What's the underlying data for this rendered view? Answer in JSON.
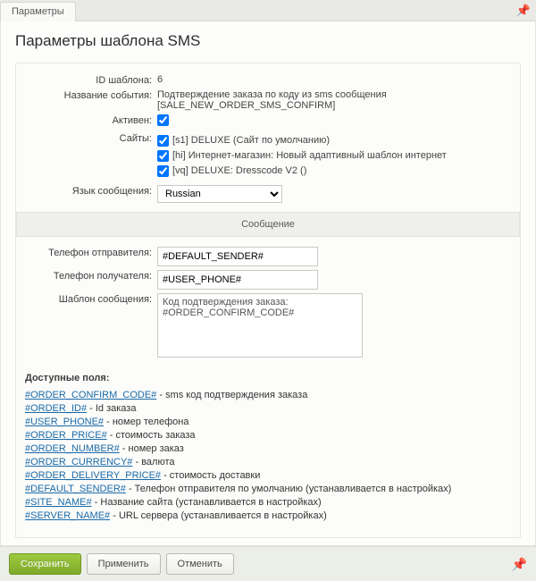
{
  "tab_label": "Параметры",
  "page_title": "Параметры шаблона SMS",
  "labels": {
    "template_id": "ID шаблона:",
    "event_name": "Название события:",
    "active": "Активен:",
    "sites": "Сайты:",
    "msg_lang": "Язык сообщения:",
    "sender_phone": "Телефон отправителя:",
    "recipient_phone": "Телефон получателя:",
    "msg_template": "Шаблон сообщения:"
  },
  "values": {
    "template_id": "6",
    "event_name": "Подтверждение заказа по коду из sms сообщения [SALE_NEW_ORDER_SMS_CONFIRM]",
    "active": true,
    "sites": [
      {
        "checked": true,
        "label": "[s1] DELUXE (Сайт по умолчанию)"
      },
      {
        "checked": true,
        "label": "[hi] Интернет-магазин: Новый адаптивный шаблон интернет"
      },
      {
        "checked": true,
        "label": "[vq] DELUXE: Dresscode V2 ()"
      }
    ],
    "msg_lang_selected": "Russian",
    "sender_phone": "#DEFAULT_SENDER#",
    "recipient_phone": "#USER_PHONE#",
    "msg_template": "Код подтверждения заказа:\n#ORDER_CONFIRM_CODE#"
  },
  "section_message": "Сообщение",
  "available_title": "Доступные поля:",
  "available_fields": [
    {
      "code": "#ORDER_CONFIRM_CODE#",
      "desc": " - sms код подтверждения заказа"
    },
    {
      "code": "#ORDER_ID#",
      "desc": " - Id заказа"
    },
    {
      "code": "#USER_PHONE#",
      "desc": " - номер телефона"
    },
    {
      "code": "#ORDER_PRICE#",
      "desc": " - стоимость заказа"
    },
    {
      "code": "#ORDER_NUMBER#",
      "desc": " - номер заказ"
    },
    {
      "code": "#ORDER_CURRENCY#",
      "desc": " - валюта"
    },
    {
      "code": "#ORDER_DELIVERY_PRICE#",
      "desc": " - стоимость доставки"
    },
    {
      "code": "#DEFAULT_SENDER#",
      "desc": " - Телефон отправителя по умолчанию (устанавливается в настройках)"
    },
    {
      "code": "#SITE_NAME#",
      "desc": " - Название сайта (устанавливается в настройках)"
    },
    {
      "code": "#SERVER_NAME#",
      "desc": " - URL сервера (устанавливается в настройках)"
    }
  ],
  "buttons": {
    "save": "Сохранить",
    "apply": "Применить",
    "cancel": "Отменить"
  }
}
